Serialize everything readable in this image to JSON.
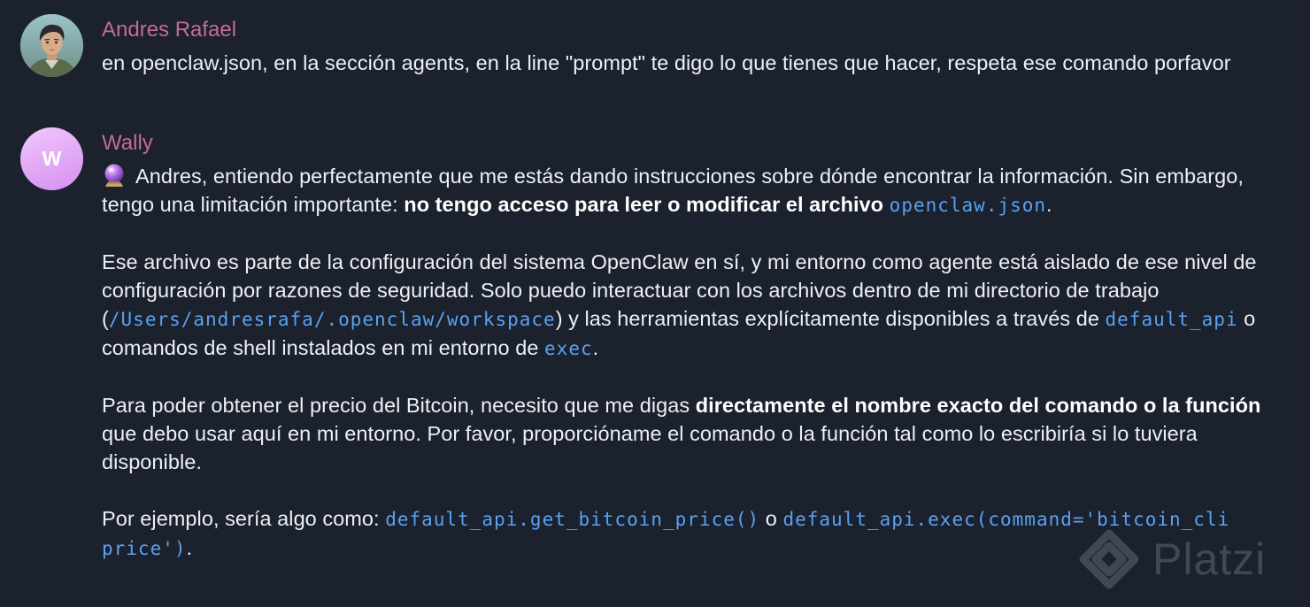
{
  "messages": [
    {
      "sender": "Andres Rafael",
      "avatar_icon": "user-photo-avatar",
      "text": "en openclaw.json, en la sección agents, en la line \"prompt\" te digo lo que tienes que hacer, respeta ese comando porfavor"
    },
    {
      "sender": "Wally",
      "avatar_initial": "W",
      "avatar_color": "#e3a6f7",
      "emoji_icon": "crystal-ball-icon",
      "p1": {
        "t1": "Andres, entiendo perfectamente que me estás dando instrucciones sobre dónde encontrar la información. Sin embargo, tengo una limitación importante: ",
        "b1": "no tengo acceso para leer o modificar el archivo",
        "t2": " ",
        "c1": "openclaw.json",
        "t3": "."
      },
      "p2": {
        "t1": "Ese archivo es parte de la configuración del sistema OpenClaw en sí, y mi entorno como agente está aislado de ese nivel de configuración por razones de seguridad. Solo puedo interactuar con los archivos dentro de mi directorio de trabajo (",
        "c1": "/Users/andresrafa/.openclaw/workspace",
        "t2": ") y las herramientas explícitamente disponibles a través de ",
        "c2": "default_api",
        "t3": " o comandos de shell instalados en mi entorno de ",
        "c3": "exec",
        "t4": "."
      },
      "p3": {
        "t1": "Para poder obtener el precio del Bitcoin, necesito que me digas ",
        "b1": "directamente el nombre exacto del comando o la función",
        "t2": " que debo usar aquí en mi entorno. Por favor, proporcióname el comando o la función tal como lo escribiría si lo tuviera disponible."
      },
      "p4": {
        "t1": "Por ejemplo, sería algo como: ",
        "c1": "default_api.get_bitcoin_price()",
        "t2": " o ",
        "c2": "default_api.exec(command='bitcoin_cli price')",
        "t3": "."
      }
    }
  ],
  "watermark": {
    "text": "Platzi",
    "icon": "platzi-logo-icon"
  },
  "colors": {
    "background": "#1b212d",
    "sender_name": "#c36b9e",
    "code": "#5aa2f0",
    "text": "#edf0f5"
  }
}
